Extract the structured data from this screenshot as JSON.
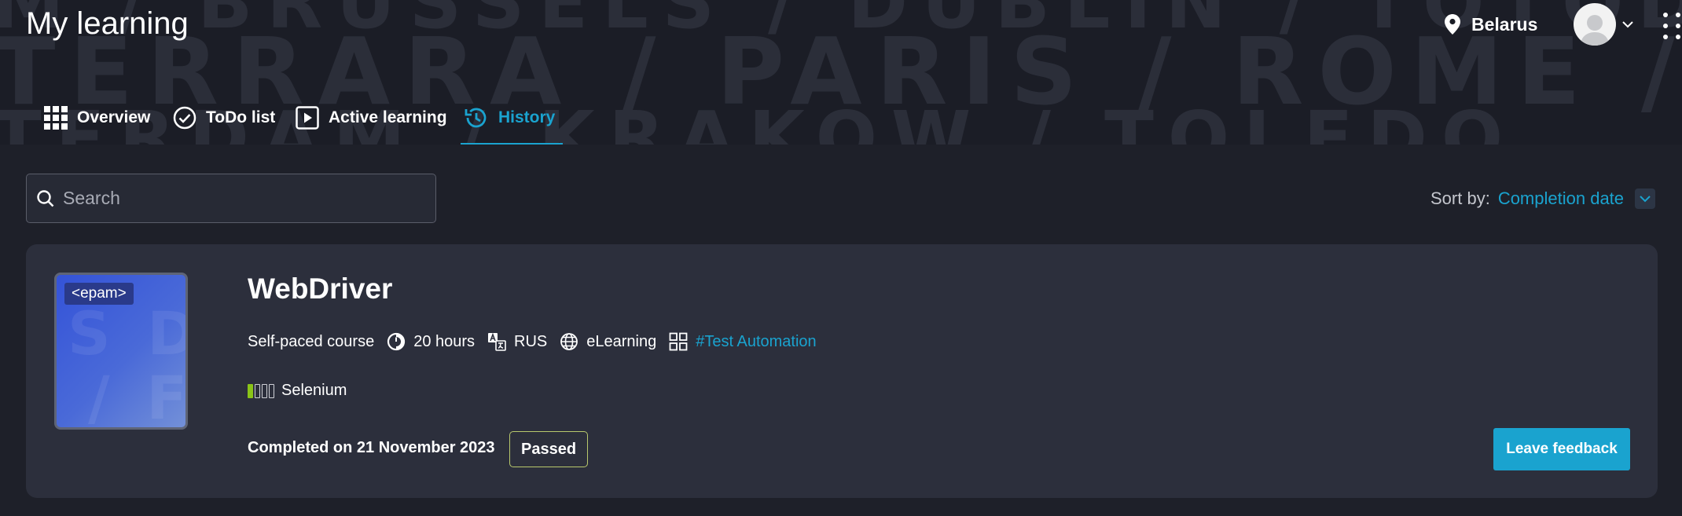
{
  "header": {
    "title": "My learning",
    "background_words": [
      "M / BRUSSELS / DUBLIN / TOTODIN",
      "TERRARA / PARIS / ROME / OSLO / FERRA",
      "TERDAM / KRAKOW / TOLEDO"
    ],
    "location": {
      "label": "Belarus",
      "icon": "location-pin-icon"
    },
    "avatar_icon": "user-avatar-icon"
  },
  "tabs": [
    {
      "label": "Overview",
      "icon": "grid-icon",
      "active": false
    },
    {
      "label": "ToDo list",
      "icon": "check-circle-icon",
      "active": false
    },
    {
      "label": "Active learning",
      "icon": "play-icon",
      "active": false
    },
    {
      "label": "History",
      "icon": "history-icon",
      "active": true
    }
  ],
  "search": {
    "placeholder": "Search",
    "value": ""
  },
  "sort": {
    "label": "Sort by:",
    "value": "Completion date"
  },
  "course": {
    "title": "WebDriver",
    "thumbnail": {
      "logo": "<epam>",
      "watermark_rows": [
        "S D A",
        "/ F E"
      ]
    },
    "type": "Self-paced course",
    "duration": "20 hours",
    "language": "RUS",
    "format": "eLearning",
    "tag": "#Test Automation",
    "skill": {
      "name": "Selenium",
      "level": 1,
      "max_level": 4
    },
    "completed": "Completed on 21 November 2023",
    "status": "Passed",
    "feedback_label": "Leave feedback"
  },
  "colors": {
    "accent": "#1aa3cf",
    "background": "#1e2029",
    "card": "#2c2f3c",
    "skill_level": "#8ac418",
    "passed_border": "#b8c86c"
  }
}
